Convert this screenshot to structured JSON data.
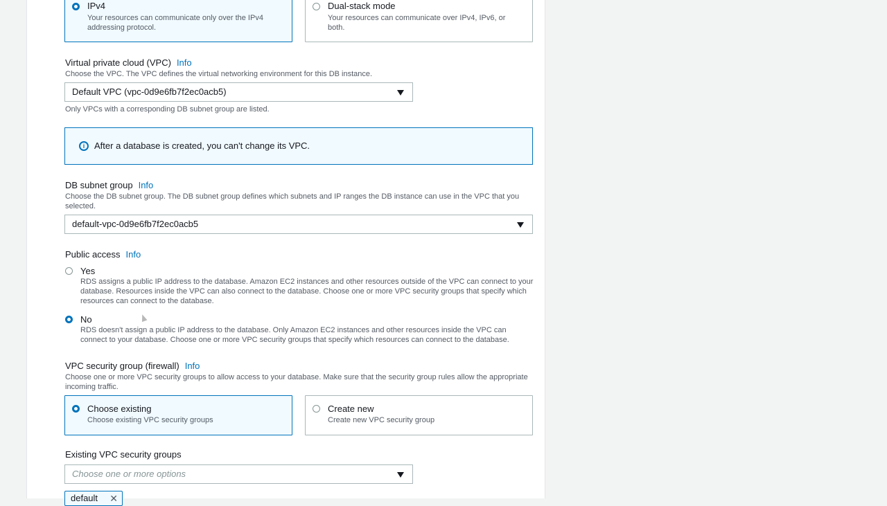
{
  "network_type": {
    "ipv4": {
      "title": "IPv4",
      "desc": "Your resources can communicate only over the IPv4 addressing protocol."
    },
    "dual": {
      "title": "Dual-stack mode",
      "desc": "Your resources can communicate over IPv4, IPv6, or both."
    }
  },
  "vpc": {
    "label": "Virtual private cloud (VPC)",
    "info": "Info",
    "desc": "Choose the VPC. The VPC defines the virtual networking environment for this DB instance.",
    "value": "Default VPC (vpc-0d9e6fb7f2ec0acb5)",
    "hint": "Only VPCs with a corresponding DB subnet group are listed."
  },
  "alert": {
    "message": "After a database is created, you can't change its VPC."
  },
  "subnet": {
    "label": "DB subnet group",
    "info": "Info",
    "desc": "Choose the DB subnet group. The DB subnet group defines which subnets and IP ranges the DB instance can use in the VPC that you selected.",
    "value": "default-vpc-0d9e6fb7f2ec0acb5"
  },
  "public_access": {
    "label": "Public access",
    "info": "Info",
    "yes": {
      "title": "Yes",
      "desc": "RDS assigns a public IP address to the database. Amazon EC2 instances and other resources outside of the VPC can connect to your database. Resources inside the VPC can also connect to the database. Choose one or more VPC security groups that specify which resources can connect to the database."
    },
    "no": {
      "title": "No",
      "desc": "RDS doesn't assign a public IP address to the database. Only Amazon EC2 instances and other resources inside the VPC can connect to your database. Choose one or more VPC security groups that specify which resources can connect to the database."
    }
  },
  "security_group": {
    "label": "VPC security group (firewall)",
    "info": "Info",
    "desc": "Choose one or more VPC security groups to allow access to your database. Make sure that the security group rules allow the appropriate incoming traffic.",
    "existing": {
      "title": "Choose existing",
      "desc": "Choose existing VPC security groups"
    },
    "new": {
      "title": "Create new",
      "desc": "Create new VPC security group"
    }
  },
  "existing_groups": {
    "label": "Existing VPC security groups",
    "placeholder": "Choose one or more options",
    "token": "default"
  },
  "colors": {
    "accent": "#0073bb",
    "selected_bg": "#f1faff",
    "border": "#aab7b8"
  }
}
